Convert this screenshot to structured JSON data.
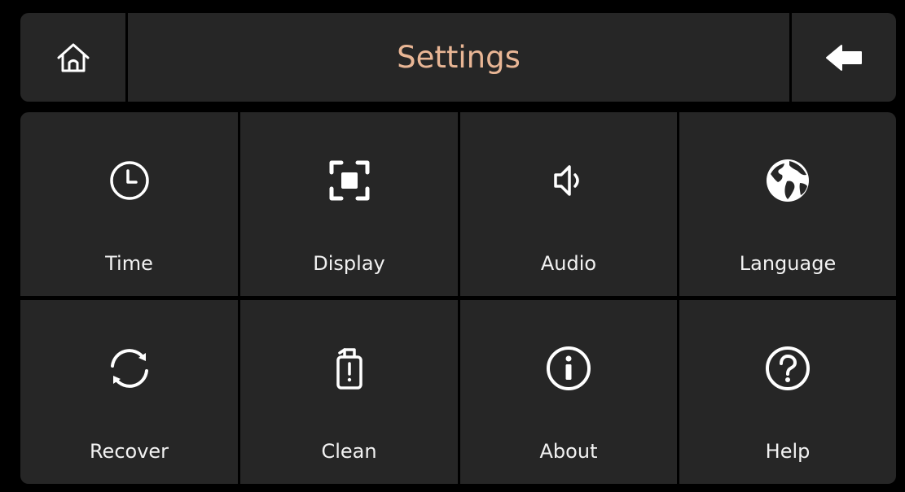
{
  "header": {
    "title": "Settings",
    "home_icon": "home-icon",
    "back_icon": "arrow-left-icon"
  },
  "tiles": [
    {
      "label": "Time",
      "icon": "clock-icon"
    },
    {
      "label": "Display",
      "icon": "display-icon"
    },
    {
      "label": "Audio",
      "icon": "speaker-icon"
    },
    {
      "label": "Language",
      "icon": "globe-icon"
    },
    {
      "label": "Recover",
      "icon": "refresh-icon"
    },
    {
      "label": "Clean",
      "icon": "clean-icon"
    },
    {
      "label": "About",
      "icon": "info-icon"
    },
    {
      "label": "Help",
      "icon": "help-icon"
    }
  ],
  "colors": {
    "background": "#000000",
    "panel": "#262626",
    "title": "#e9b695",
    "text": "#f2f2f2"
  }
}
